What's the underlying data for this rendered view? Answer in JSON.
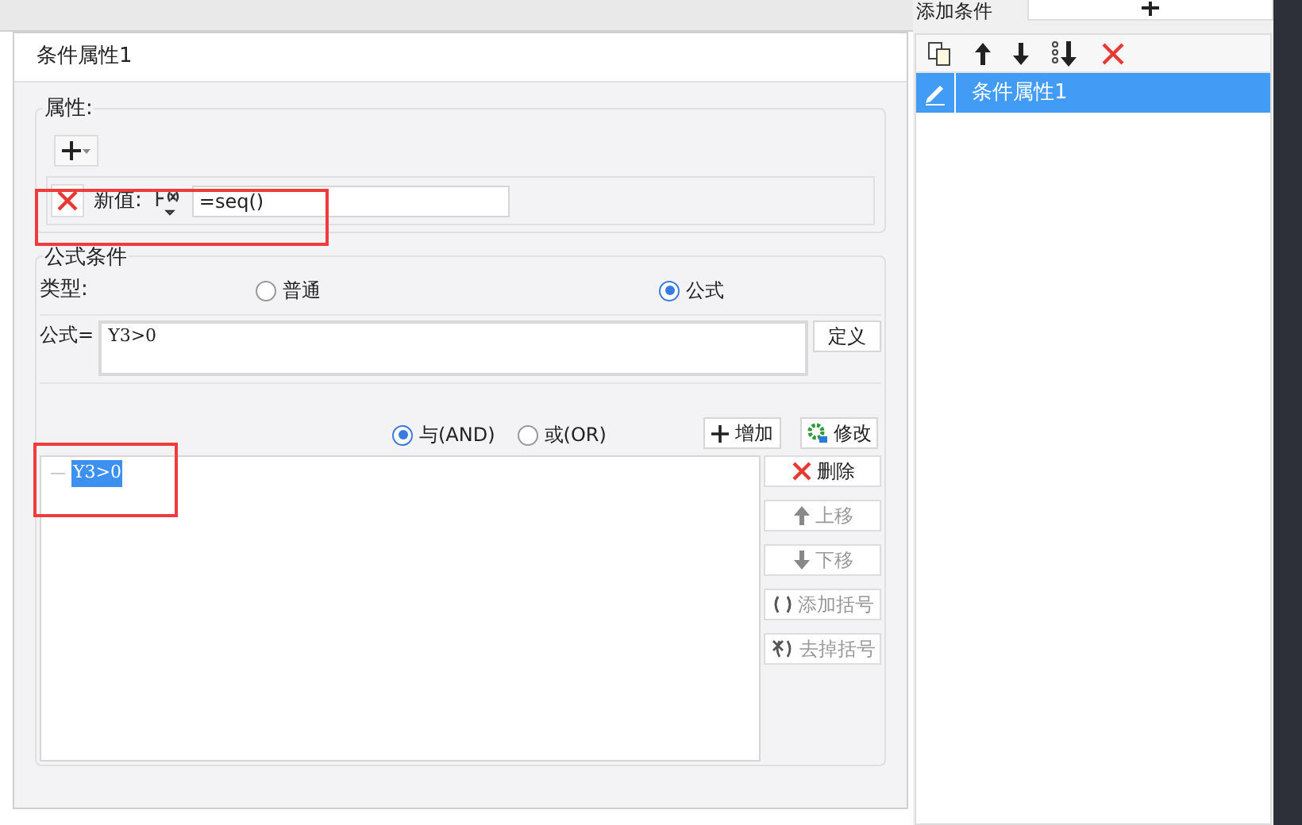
{
  "dialog": {
    "title": "条件属性1"
  },
  "properties": {
    "legend": "属性:",
    "rows": [
      {
        "label": "新值:",
        "value": "=seq()"
      }
    ]
  },
  "formula_condition": {
    "legend": "公式条件",
    "type_label": "类型:",
    "types": [
      {
        "label": "普通",
        "selected": false
      },
      {
        "label": "公式",
        "selected": true
      }
    ],
    "formula_label": "公式=",
    "formula": "Y3>0",
    "define_button": "定义",
    "joins": [
      {
        "label": "与(AND)",
        "selected": true
      },
      {
        "label": "或(OR)",
        "selected": false
      }
    ],
    "add_button": "增加",
    "modify_button": "修改",
    "conditions": [
      {
        "text": "Y3>0",
        "selected": true
      }
    ],
    "side_buttons": [
      {
        "kind": "delete",
        "label": "删除",
        "disabled": false
      },
      {
        "kind": "up",
        "label": "上移",
        "disabled": true
      },
      {
        "kind": "down",
        "label": "下移",
        "disabled": true
      },
      {
        "kind": "add-paren",
        "label": "添加括号",
        "disabled": true
      },
      {
        "kind": "remove-paren",
        "label": "去掉括号",
        "disabled": true
      }
    ]
  },
  "side_panel": {
    "heading": "添加条件",
    "items": [
      {
        "label": "条件属性1",
        "selected": true
      }
    ]
  }
}
